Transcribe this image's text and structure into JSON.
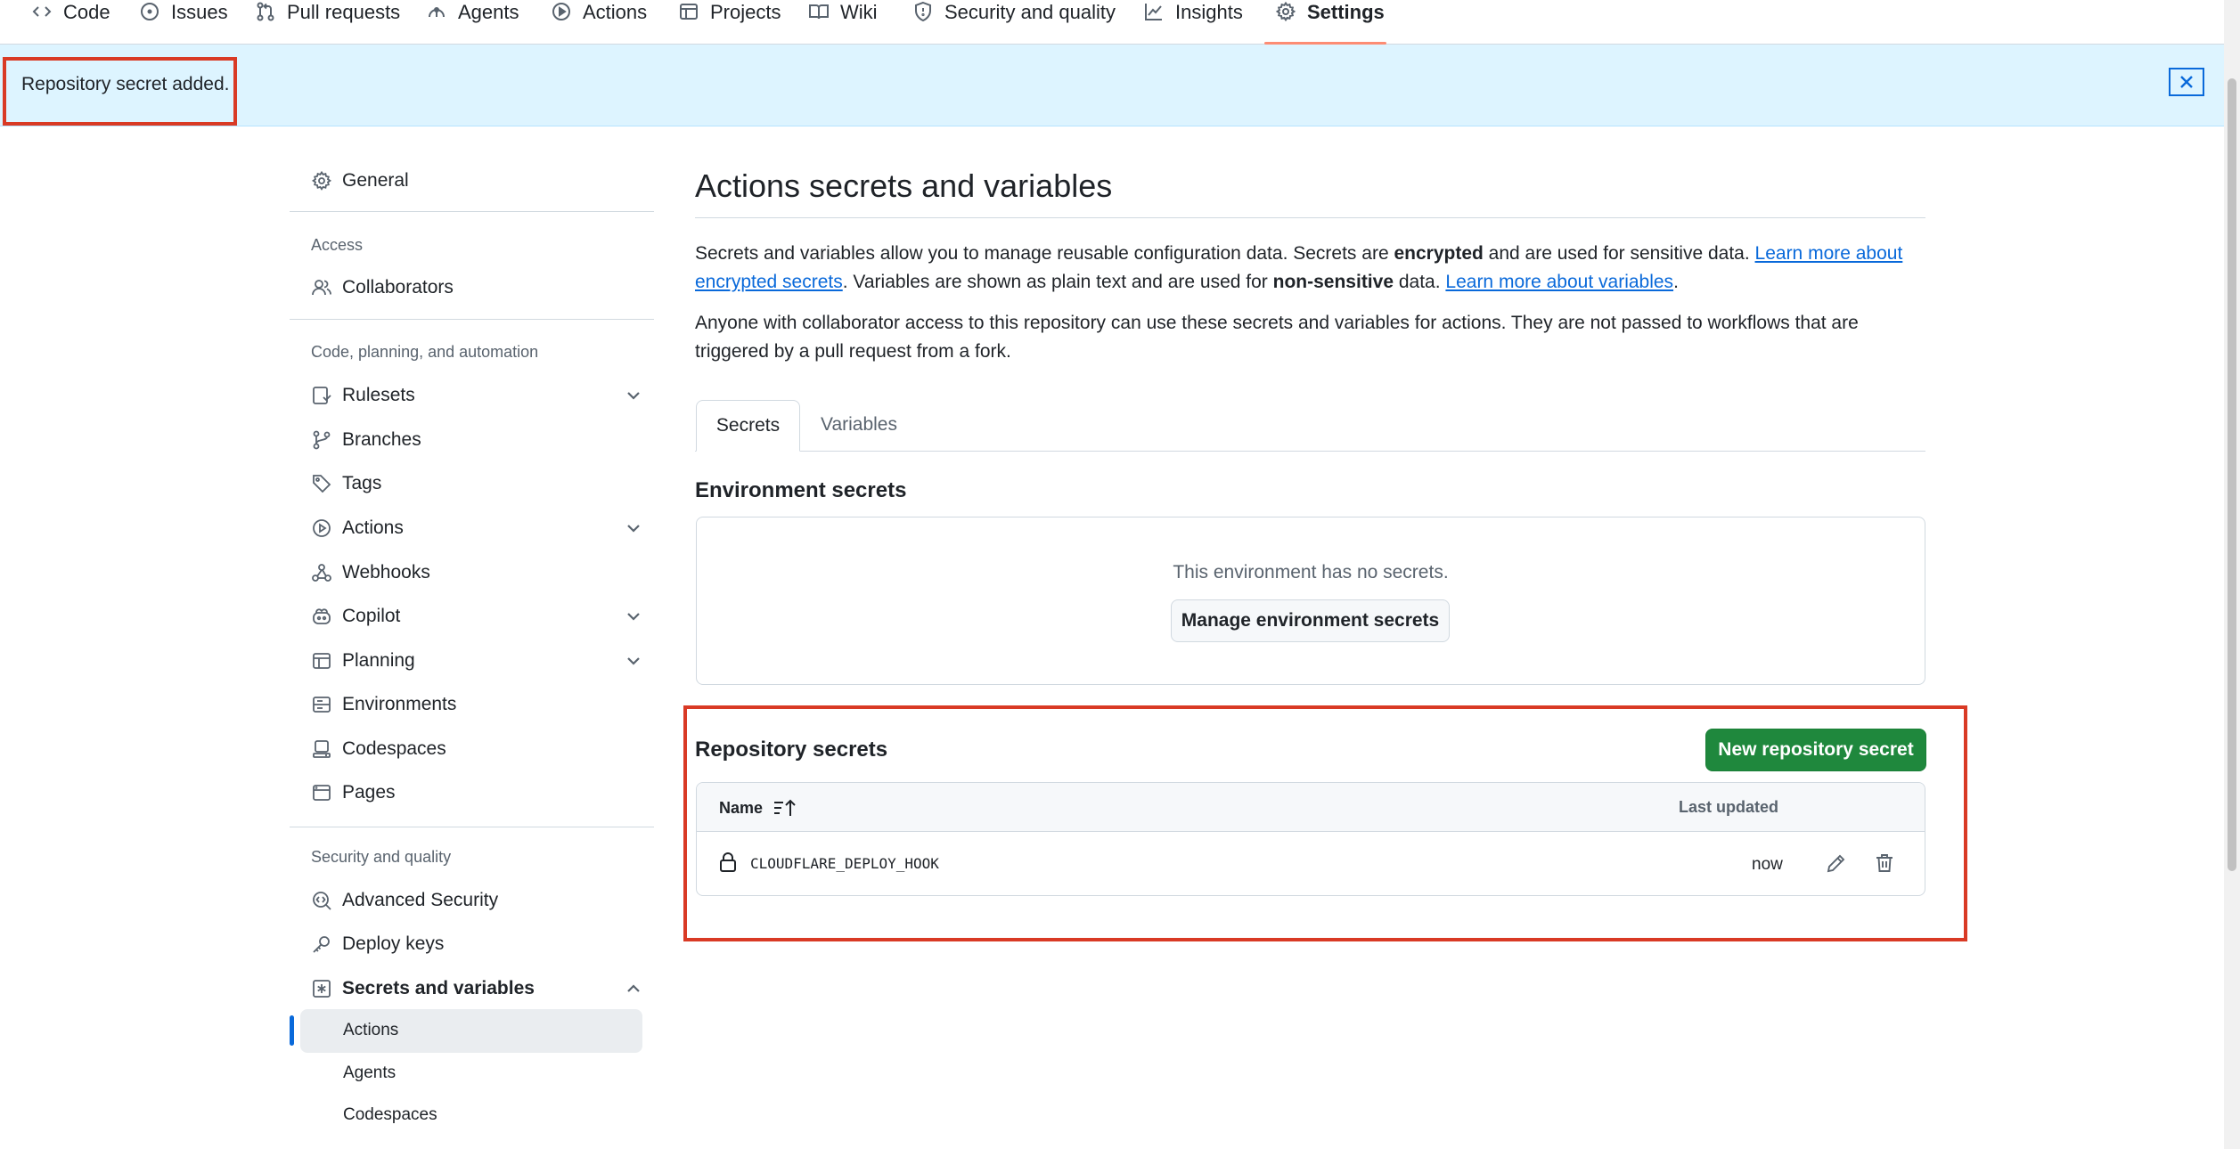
{
  "repo_nav": {
    "tabs": [
      {
        "label": "Code",
        "icon": "code-icon"
      },
      {
        "label": "Issues",
        "icon": "issue-icon"
      },
      {
        "label": "Pull requests",
        "icon": "pull-request-icon"
      },
      {
        "label": "Agents",
        "icon": "agent-icon"
      },
      {
        "label": "Actions",
        "icon": "play-icon"
      },
      {
        "label": "Projects",
        "icon": "table-icon"
      },
      {
        "label": "Wiki",
        "icon": "book-icon"
      },
      {
        "label": "Security and quality",
        "icon": "shield-icon"
      },
      {
        "label": "Insights",
        "icon": "graph-icon"
      },
      {
        "label": "Settings",
        "icon": "gear-icon",
        "active": true
      }
    ]
  },
  "flash": {
    "message": "Repository secret added."
  },
  "sidebar": {
    "general": "General",
    "access_heading": "Access",
    "collaborators": "Collaborators",
    "code_heading": "Code, planning, and automation",
    "rulesets": "Rulesets",
    "branches": "Branches",
    "tags": "Tags",
    "actions": "Actions",
    "webhooks": "Webhooks",
    "copilot": "Copilot",
    "planning": "Planning",
    "environments": "Environments",
    "codespaces": "Codespaces",
    "pages": "Pages",
    "security_heading": "Security and quality",
    "advanced_security": "Advanced Security",
    "deploy_keys": "Deploy keys",
    "secrets_and_variables": "Secrets and variables",
    "sub_actions": "Actions",
    "sub_agents": "Agents",
    "sub_codespaces": "Codespaces"
  },
  "main": {
    "title": "Actions secrets and variables",
    "para1": {
      "t1": "Secrets and variables allow you to manage reusable configuration data. Secrets are ",
      "b1": "encrypted",
      "t2": " and are used for sensitive data. ",
      "link1": "Learn more about encrypted secrets",
      "t3": ". Variables are shown as plain text and are used for ",
      "b2": "non-sensitive",
      "t4": " data. ",
      "link2": "Learn more about variables",
      "t5": "."
    },
    "para2": "Anyone with collaborator access to this repository can use these secrets and variables for actions. They are not passed to workflows that are triggered by a pull request from a fork.",
    "tabs": {
      "secrets": "Secrets",
      "variables": "Variables"
    },
    "environment_secrets": {
      "heading": "Environment secrets",
      "empty": "This environment has no secrets.",
      "button": "Manage environment secrets"
    },
    "repository_secrets": {
      "heading": "Repository secrets",
      "new_button": "New repository secret",
      "columns": {
        "name": "Name",
        "last_updated": "Last updated"
      },
      "rows": [
        {
          "name": "CLOUDFLARE_DEPLOY_HOOK",
          "updated": "now"
        }
      ]
    }
  },
  "colors": {
    "accent": "#0969da",
    "primary_button": "#1f883d",
    "flash_bg": "#ddf4ff",
    "highlight": "#d93a25"
  }
}
